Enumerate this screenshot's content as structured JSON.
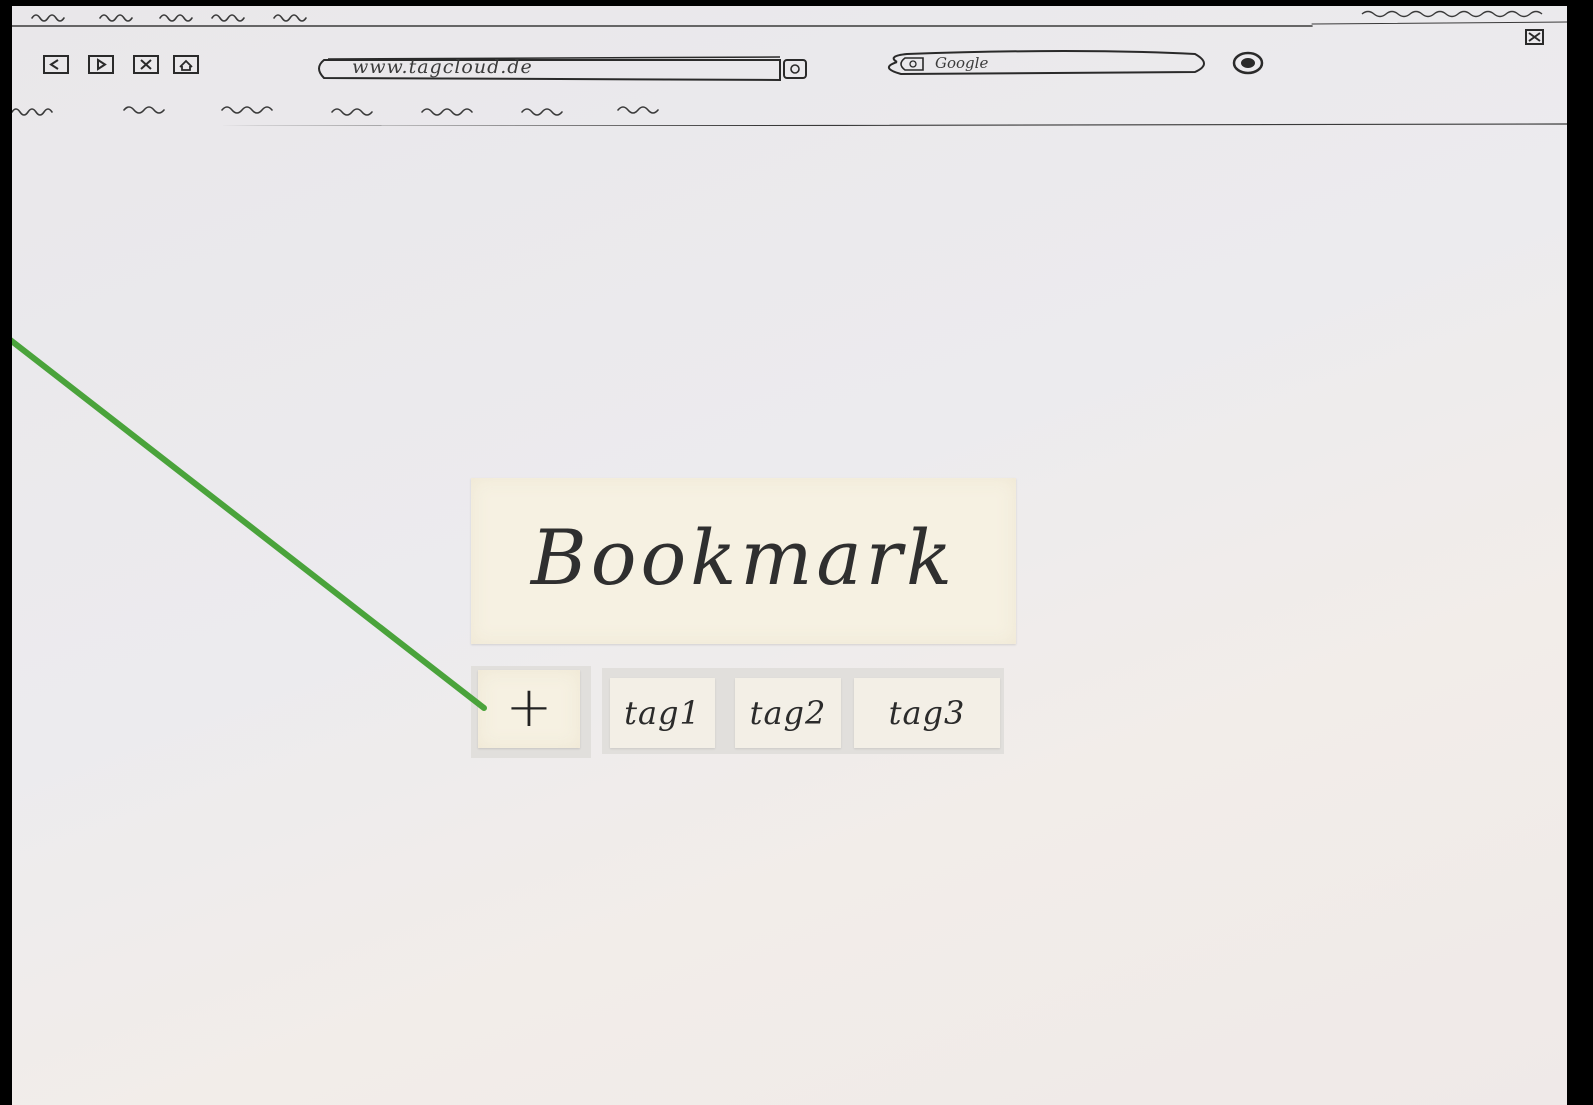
{
  "browser": {
    "url": "www.tagcloud.de",
    "search_placeholder": "Google"
  },
  "bookmark": {
    "label": "Bookmark"
  },
  "add_tag": {
    "label": "+"
  },
  "tags": [
    {
      "label": "tag1"
    },
    {
      "label": "tag2"
    },
    {
      "label": "tag3"
    }
  ],
  "colors": {
    "paper": "#ecebee",
    "sticky_note": "#f6f1e2",
    "annotation_line": "#4aa33b",
    "pencil": "#2f2f2f"
  },
  "icons": {
    "nav_buttons": [
      "back-icon",
      "forward-icon",
      "stop-icon",
      "home-icon"
    ],
    "search_go": "search-go-icon",
    "window_close": "close-icon"
  }
}
